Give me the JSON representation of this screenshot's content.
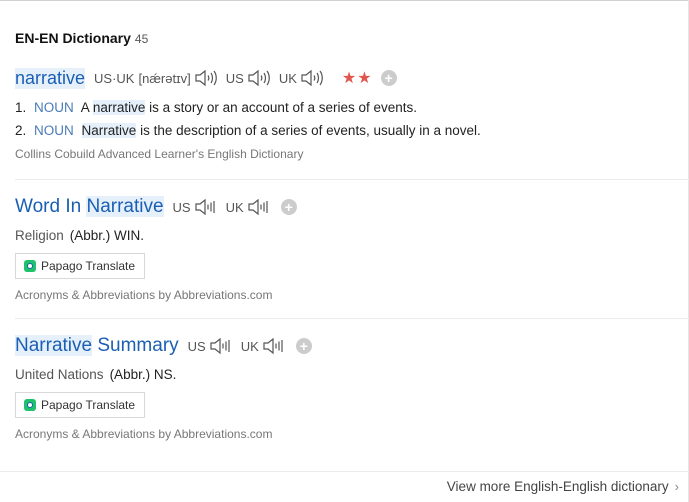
{
  "section": {
    "title": "EN-EN Dictionary",
    "count": "45"
  },
  "entry1": {
    "headword": "narrative",
    "pron_label": "US·UK",
    "pron_text": "[nǽrətɪv]",
    "us_label": "US",
    "uk_label": "UK",
    "stars": "★★",
    "plus": "+",
    "defs": [
      {
        "num": "1.",
        "pos": "NOUN",
        "pre": "A",
        "hl": "narrative",
        "post": "is a story or an account of a series of events."
      },
      {
        "num": "2.",
        "pos": "NOUN",
        "pre": "",
        "hl": "Narrative",
        "post": "is the description of a series of events, usually in a novel."
      }
    ],
    "source": "Collins Cobuild Advanced Learner's English Dictionary"
  },
  "entry2": {
    "pre": "Word In",
    "hl": "Narrative",
    "post": "",
    "us_label": "US",
    "uk_label": "UK",
    "plus": "+",
    "category": "Religion",
    "abbr": "(Abbr.) WIN.",
    "papago": "Papago Translate",
    "source": "Acronyms & Abbreviations by Abbreviations.com"
  },
  "entry3": {
    "pre": "",
    "hl": "Narrative",
    "post": "Summary",
    "us_label": "US",
    "uk_label": "UK",
    "plus": "+",
    "category": "United Nations",
    "abbr": "(Abbr.) NS.",
    "papago": "Papago Translate",
    "source": "Acronyms & Abbreviations by Abbreviations.com"
  },
  "footer": {
    "view_more": "View more English-English dictionary",
    "chevron": "›"
  },
  "icons": {
    "speaker": "speaker-icon",
    "papago": "papago-icon",
    "chevron": "chevron-right-icon"
  },
  "colors": {
    "link": "#1a5fb4",
    "star": "#e0574f",
    "highlight": "#e6f0fb"
  }
}
